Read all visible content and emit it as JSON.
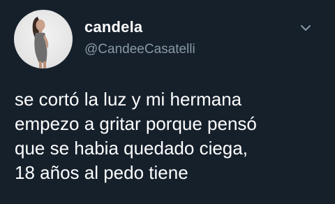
{
  "tweet": {
    "display_name": "candela",
    "handle": "@CandeeCasatelli",
    "text": "se cortó la luz y mi hermana\nempezo a gritar porque pensó\nque se habia quedado ciega,\n18 años al pedo tiene",
    "menu_icon": "chevron-down-icon",
    "avatar_icon": "profile-photo"
  },
  "colors": {
    "background": "#15202b",
    "name": "#ffffff",
    "handle": "#8899a6",
    "text": "#ffffff"
  }
}
